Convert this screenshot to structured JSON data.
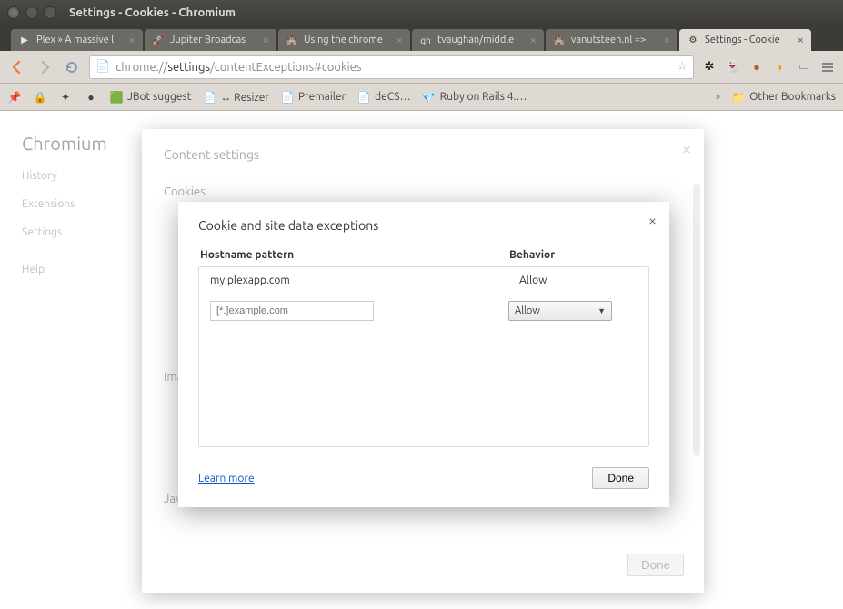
{
  "window": {
    "title": "Settings - Cookies - Chromium"
  },
  "tabs": [
    {
      "title": "Plex » A massive l",
      "favicon": "▶"
    },
    {
      "title": "Jupiter Broadcas",
      "favicon": "🚀"
    },
    {
      "title": "Using the chrome",
      "favicon": "🏰"
    },
    {
      "title": "tvaughan/middle",
      "favicon": "gh"
    },
    {
      "title": "vanutsteen.nl =>",
      "favicon": "🏰"
    },
    {
      "title": "Settings - Cookie",
      "favicon": "⚙",
      "active": true
    }
  ],
  "omnibox": {
    "scheme": "chrome://",
    "host": "settings",
    "path": "/contentExceptions#cookies"
  },
  "bookmarks": [
    {
      "label": "",
      "icon": "📌"
    },
    {
      "label": "",
      "icon": "🔒"
    },
    {
      "label": "",
      "icon": "✦"
    },
    {
      "label": "",
      "icon": "●"
    },
    {
      "label": "JBot suggest",
      "icon": "🟩"
    },
    {
      "label": "↔ Resizer",
      "icon": "📄"
    },
    {
      "label": "Premailer",
      "icon": "📄"
    },
    {
      "label": "deCS…",
      "icon": "📄"
    },
    {
      "label": "Ruby on Rails 4.…",
      "icon": "💎"
    }
  ],
  "other_bookmarks_label": "Other Bookmarks",
  "settings_bg": {
    "brand": "Chromium",
    "items": [
      "History",
      "Extensions",
      "Settings",
      "Help"
    ],
    "section_ima": "Ima",
    "section_js": "JavaScript"
  },
  "modal1": {
    "title": "Content settings",
    "section_cookies": "Cookies",
    "done_label": "Done"
  },
  "modal2": {
    "title": "Cookie and site data exceptions",
    "col_host": "Hostname pattern",
    "col_behavior": "Behavior",
    "rows": [
      {
        "host": "my.plexapp.com",
        "behavior": "Allow"
      }
    ],
    "input_placeholder": "[*.]example.com",
    "select_value": "Allow",
    "learn_more": "Learn more",
    "done_label": "Done"
  }
}
